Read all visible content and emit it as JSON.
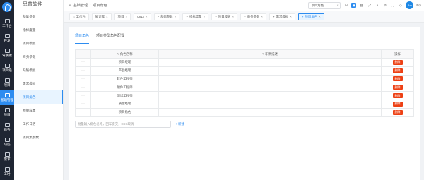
{
  "app": {
    "name": "思普软件"
  },
  "rail": [
    {
      "label": "工作台",
      "active": false
    },
    {
      "label": "开发",
      "active": false
    },
    {
      "label": "驾驶舱",
      "active": false
    },
    {
      "label": "项目级",
      "active": false
    },
    {
      "label": "项目",
      "active": false
    },
    {
      "label": "基础管理",
      "active": true
    },
    {
      "label": "项目",
      "active": false
    },
    {
      "label": "商务",
      "active": false
    },
    {
      "label": "缺陷",
      "active": false
    },
    {
      "label": "需求",
      "active": false
    },
    {
      "label": "工时",
      "active": false
    }
  ],
  "sidebar": {
    "items": [
      {
        "label": "基础参数",
        "active": false
      },
      {
        "label": "指标度量",
        "active": false
      },
      {
        "label": "项目模板",
        "active": false
      },
      {
        "label": "商务参数",
        "active": false
      },
      {
        "label": "缺陷模板",
        "active": false
      },
      {
        "label": "需求模板",
        "active": false
      },
      {
        "label": "项目角色",
        "active": true
      },
      {
        "label": "预算成本",
        "active": false
      },
      {
        "label": "工作日历",
        "active": false
      },
      {
        "label": "项目集参数",
        "active": false
      }
    ]
  },
  "topbar": {
    "collapse_icon": "»",
    "breadcrumb": [
      "基础管理",
      "项目角色"
    ],
    "role_select": "项目角色",
    "username": "Bry"
  },
  "tabs": [
    {
      "label": "工作台",
      "icon": "home",
      "closable": false,
      "active": false
    },
    {
      "label": "知识库",
      "icon": "",
      "closable": true,
      "active": false
    },
    {
      "label": "项目",
      "icon": "",
      "closable": true,
      "active": false
    },
    {
      "label": "0813",
      "icon": "",
      "closable": true,
      "active": false
    },
    {
      "label": "基础参数",
      "icon": "tree",
      "closable": true,
      "active": false
    },
    {
      "label": "指标度量",
      "icon": "tree",
      "closable": true,
      "active": false
    },
    {
      "label": "项目模板",
      "icon": "tree",
      "closable": true,
      "active": false
    },
    {
      "label": "商务参数",
      "icon": "tree",
      "closable": true,
      "active": false
    },
    {
      "label": "需求模板",
      "icon": "tree",
      "closable": true,
      "active": false
    },
    {
      "label": "项目角色",
      "icon": "tree",
      "closable": true,
      "active": true
    }
  ],
  "subtabs": [
    {
      "label": "项目角色",
      "active": true
    },
    {
      "label": "项目类型角色配置",
      "active": false
    }
  ],
  "table": {
    "headers": {
      "name": "角色名称",
      "desc": "职责描述",
      "op": "操作"
    },
    "rows": [
      {
        "name": "项目经理",
        "desc": "",
        "action": "删除"
      },
      {
        "name": "产品经理",
        "desc": "",
        "action": "删除"
      },
      {
        "name": "软件工程师",
        "desc": "",
        "action": "删除"
      },
      {
        "name": "硬件工程师",
        "desc": "",
        "action": "删除"
      },
      {
        "name": "测试工程师",
        "desc": "",
        "action": "删除"
      },
      {
        "name": "质量经理",
        "desc": "",
        "action": "删除"
      },
      {
        "name": "项目角色",
        "desc": "",
        "action": "删除"
      }
    ]
  },
  "add": {
    "placeholder": "批量输入角色名称，回车提交，ESC取消",
    "add_label": "+ 新建"
  }
}
